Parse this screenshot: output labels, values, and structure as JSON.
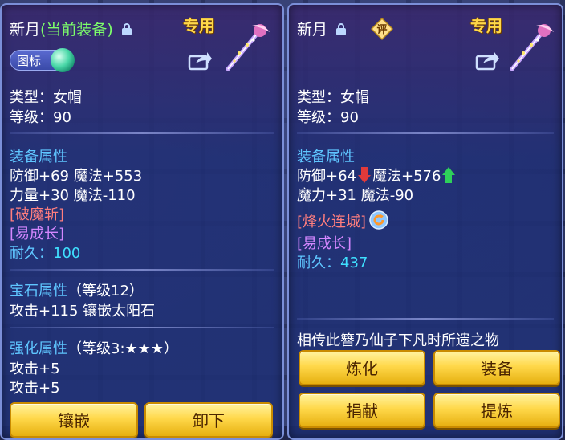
{
  "left": {
    "title_name": "新月",
    "title_suffix": "(当前装备)",
    "special_label": "专用",
    "tag_button": "图标",
    "type_line": "类型：女帽",
    "level_line": "等级：90",
    "equip_attr_header": "装备属性",
    "attr_line_1": "防御+69 魔法+553",
    "attr_line_2": "力量+30 魔法-110",
    "skill_1": "[破魔斩]",
    "skill_2": "[易成长]",
    "durability_label": "耐久：",
    "durability_value": "100",
    "gem_header": "宝石属性",
    "gem_level": "（等级12）",
    "gem_line": "攻击+115 镶嵌太阳石",
    "enhance_header": "强化属性",
    "enhance_level": "（等级3:★★★）",
    "enhance_line_1": "攻击+5",
    "enhance_line_2": "攻击+5",
    "button_inlay": "镶嵌",
    "button_unequip": "卸下"
  },
  "right": {
    "title_name": "新月",
    "eval_icon_label": "评",
    "special_label": "专用",
    "type_line": "类型：女帽",
    "level_line": "等级：90",
    "equip_attr_header": "装备属性",
    "attr_line_1a": "防御+64",
    "attr_line_1b": "魔法+576",
    "attr_line_2": "魔力+31 魔法-90",
    "skill_1": "[烽火连城]",
    "skill_2": "[易成长]",
    "durability_label": "耐久：",
    "durability_value": "437",
    "description": "相传此簪乃仙子下凡时所遗之物",
    "button_refine": "炼化",
    "button_equip": "装备",
    "button_donate": "捐献",
    "button_extract": "提炼"
  },
  "colors": {
    "attr_header": "#5fc6ff",
    "skill_red": "#ff7e7e",
    "skill_violet": "#d487ff",
    "button_gold": "#ffd84a",
    "arrow_down": "#e23a3a",
    "arrow_up": "#2ed05a"
  },
  "icons": [
    "lock-icon",
    "share-icon",
    "hairpin-item-icon",
    "green-orb-icon",
    "eval-icon",
    "refresh-skill-icon",
    "arrow-down-icon",
    "arrow-up-icon"
  ]
}
